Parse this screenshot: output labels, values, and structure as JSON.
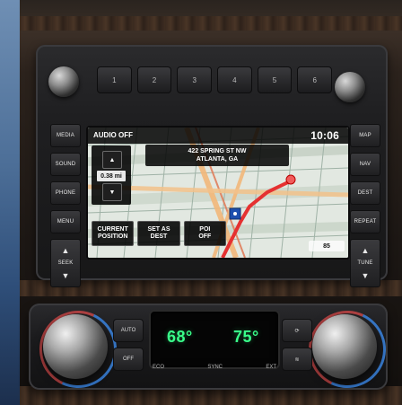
{
  "radio": {
    "preset_labels": [
      "1",
      "2",
      "3",
      "4",
      "5",
      "6"
    ],
    "left_buttons": [
      "MEDIA",
      "SOUND",
      "PHONE",
      "MENU",
      "SEEK"
    ],
    "right_buttons": [
      "MAP",
      "NAV",
      "DEST",
      "REPEAT",
      "TUNE"
    ]
  },
  "screen": {
    "audio_status": "AUDIO OFF",
    "clock": "10:06",
    "address": {
      "line1": "422 SPRING ST NW",
      "line2": "ATLANTA, GA"
    },
    "zoom_value": "0.38 mi",
    "buttons": [
      {
        "label": "CURRENT\nPOSITION"
      },
      {
        "label": "SET AS\nDEST"
      },
      {
        "label": "POI\nOFF"
      }
    ],
    "scale_label": "85"
  },
  "climate": {
    "left_temp": "68°",
    "right_temp": "75°",
    "left_buttons": [
      "AUTO",
      "OFF"
    ],
    "right_buttons": [
      "",
      ""
    ],
    "labels": [
      "ECO",
      "SYNC",
      "EXT"
    ]
  }
}
